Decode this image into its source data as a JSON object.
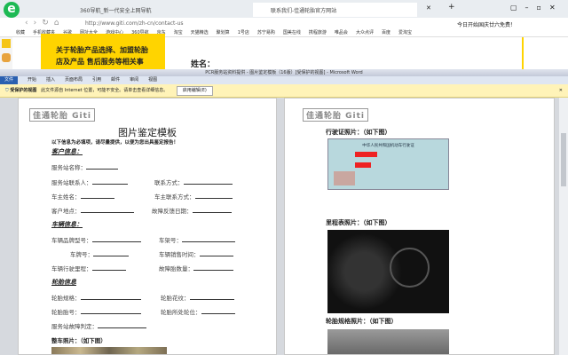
{
  "browser": {
    "tabs": [
      {
        "label": "360导航_新一代安全上网导航"
      },
      {
        "label": "联系我们-佳通轮胎官方网站"
      }
    ],
    "new_tab": "+",
    "url": "http://www.giti.com/zh-cn/contact-us",
    "search_hint": "今日开始国庆廿六免费！",
    "bookmarks": [
      "收藏",
      "手机收藏夹",
      "谷歌",
      "网址大全",
      "游戏中心",
      "360导航",
      "京东",
      "淘宝",
      "天猫精选",
      "聚划算",
      "1号店",
      "苏宁易购",
      "国美在线",
      "携程旅游",
      "唯品会",
      "大众点评",
      "百度",
      "爱淘宝"
    ]
  },
  "website": {
    "banner_text": [
      "关于轮胎产品选择、加盟轮胎",
      "店及产品 售后服务等相关事"
    ],
    "name_label": "姓名："
  },
  "word": {
    "title": "PCR服务站资料提供 - 图片鉴定模板（16版）[受保护的视图] - Microsoft Word",
    "ribbon_tabs": [
      "文件",
      "开始",
      "插入",
      "页面布局",
      "引用",
      "邮件",
      "审阅",
      "视图"
    ],
    "protected": {
      "title": "受保护的视图",
      "message": "此文件源自 Internet 位置，可能不安全。请单击查看详细信息。",
      "button": "启用编辑(E)"
    }
  },
  "doc_left": {
    "logo": "佳通轮胎 Giti",
    "title": "图片鉴定模板",
    "intro": "以下信息为必填项，请尽量提供，以便为您出具鉴定报告！",
    "sec_customer": "客户信息：",
    "f1": "服务站名称：",
    "f2": "服务站联系人：",
    "f3": "联系方式：",
    "f4": "车主姓名：",
    "f5": "车主联系方式：",
    "f6": "客户地点：",
    "f7": "故障反馈日期：",
    "sec_vehicle": "车辆信息：",
    "v1": "车辆品牌型号：",
    "v2": "车架号：",
    "v3": "车牌号：",
    "v4": "车辆销售时间：",
    "v5": "车辆行驶里程：",
    "v6": "故障胎数量：",
    "sec_tire": "轮胎信息",
    "t1": "轮胎规格：",
    "t2": "轮胎花纹：",
    "t3": "轮胎胎号：",
    "t4": "轮胎所处轮位：",
    "t5": "服务站故障判定：",
    "photo_label": "整车照片：（如下图）"
  },
  "doc_right": {
    "logo": "佳通轮胎 Giti",
    "license": "行驶证照片：（如下图）",
    "license_card": "中华人民共和国机动车行驶证",
    "odometer": "里程表照片：（如下图）",
    "tire_spec": "轮胎规格照片：（如下图）"
  }
}
